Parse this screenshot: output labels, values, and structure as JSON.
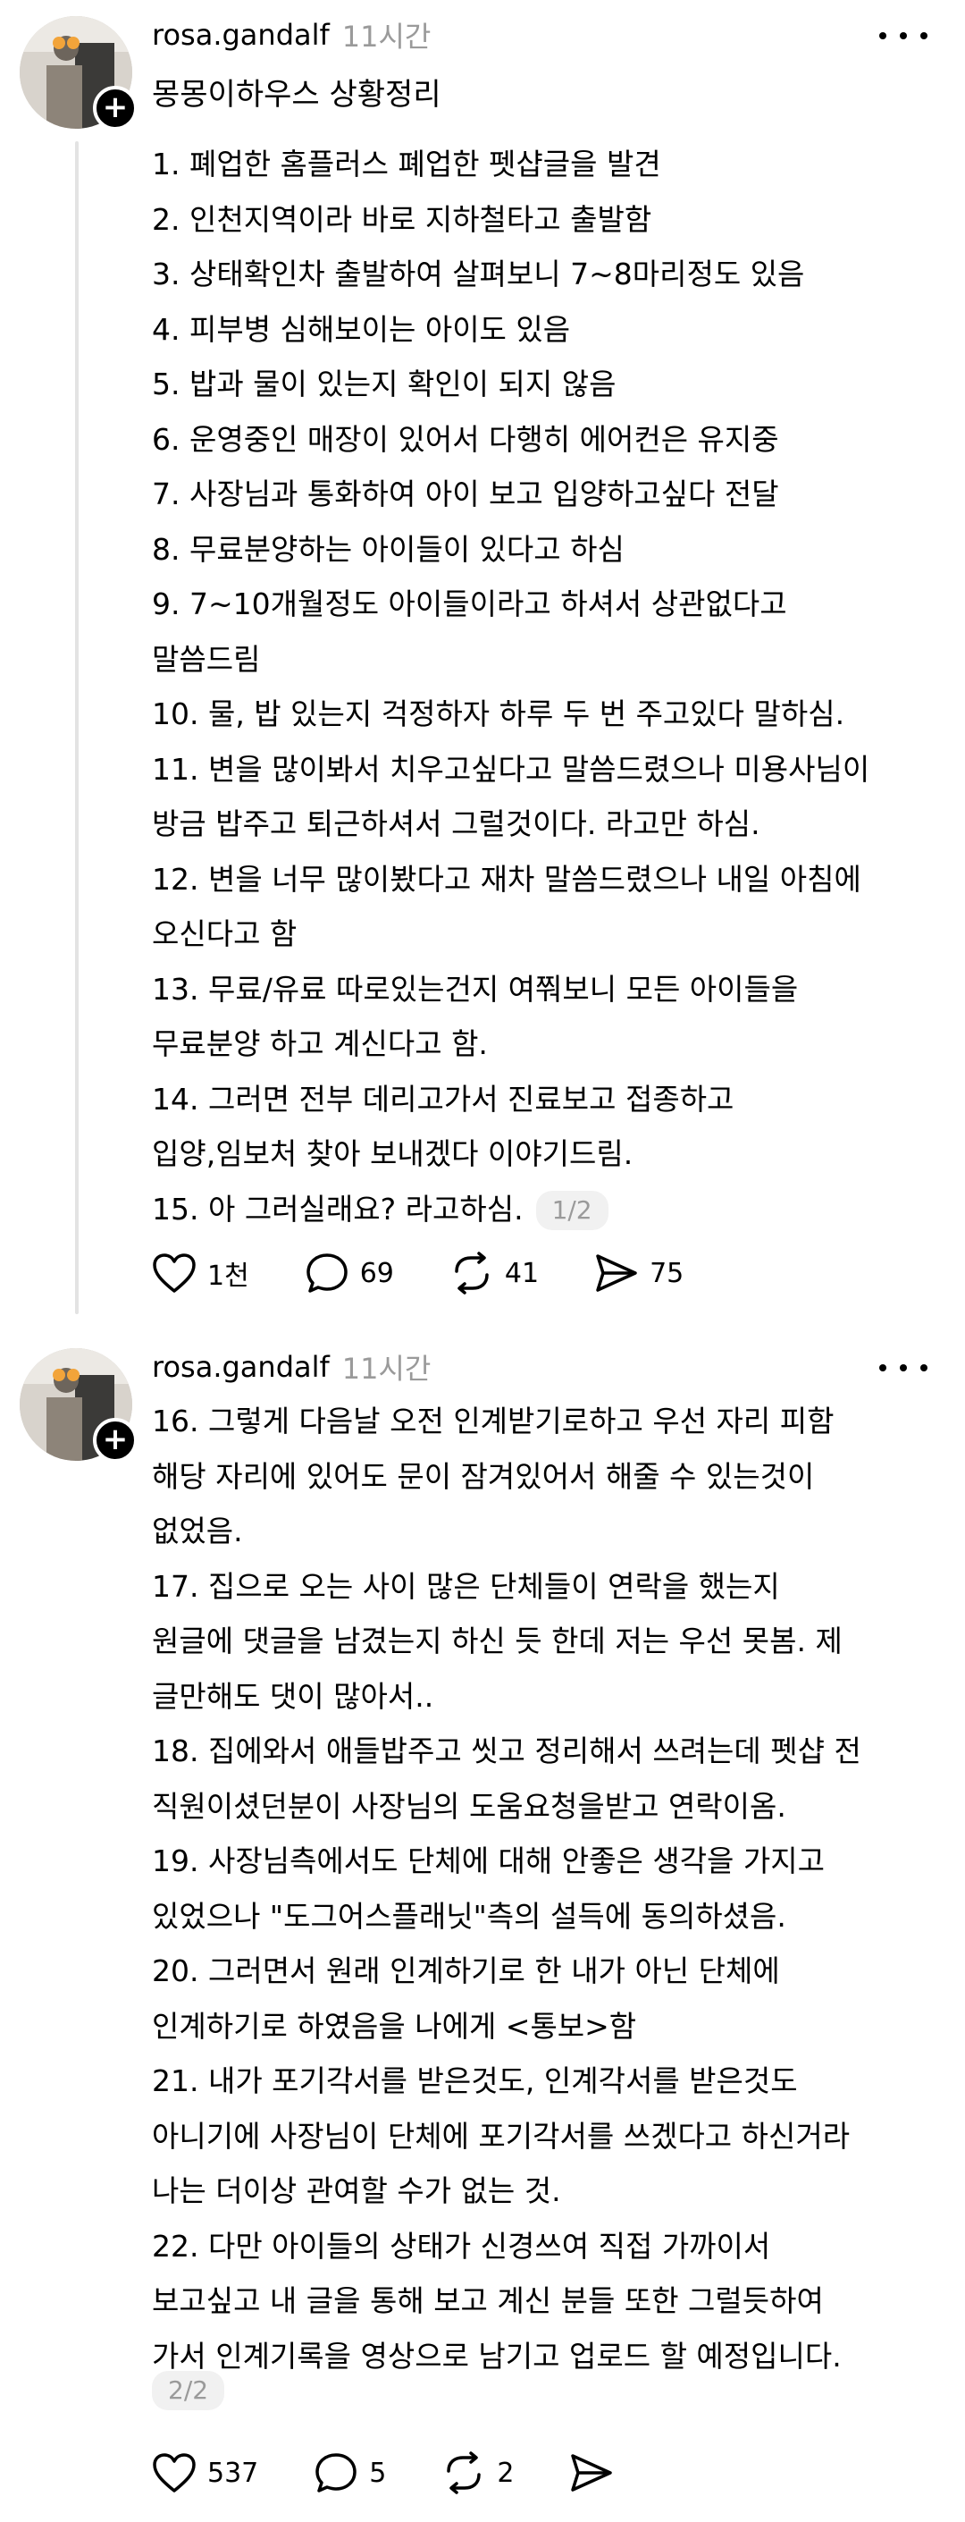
{
  "posts": [
    {
      "username": "rosa.gandalf",
      "time": "11시간",
      "title": "몽몽이하우스 상황정리",
      "lines": [
        "1. 폐업한 홈플러스 폐업한 펫샵글을 발견",
        "2. 인천지역이라 바로 지하철타고 출발함",
        "3. 상태확인차 출발하여 살펴보니 7~8마리정도 있음",
        "4. 피부병 심해보이는 아이도 있음",
        "5. 밥과 물이 있는지 확인이 되지 않음",
        "6. 운영중인 매장이 있어서 다행히 에어컨은 유지중",
        "7. 사장님과 통화하여 아이 보고 입양하고싶다 전달",
        "8. 무료분양하는 아이들이 있다고 하심",
        "9. 7~10개월정도 아이들이라고 하셔서 상관없다고",
        "말씀드림",
        "10. 물, 밥 있는지 걱정하자 하루 두 번 주고있다 말하심.",
        "11. 변을 많이봐서 치우고싶다고 말씀드렸으나 미용사님이",
        "방금 밥주고 퇴근하셔서 그럴것이다. 라고만 하심.",
        "12. 변을 너무 많이봤다고 재차 말씀드렸으나 내일 아침에",
        "오신다고 함",
        "13. 무료/유료 따로있는건지 여쭤보니 모든 아이들을",
        "무료분양 하고 계신다고 함.",
        "14. 그러면 전부 데리고가서 진료보고 접종하고",
        "입양,임보처 찾아 보내겠다 이야기드림.",
        "15. 아 그러실래요? 라고하심."
      ],
      "page_badge": "1/2",
      "likes": "1천",
      "comments": "69",
      "reposts": "41",
      "shares": "75"
    },
    {
      "username": "rosa.gandalf",
      "time": "11시간",
      "lines": [
        "16. 그렇게 다음날 오전 인계받기로하고 우선 자리 피함",
        "해당 자리에 있어도 문이 잠겨있어서 해줄 수 있는것이",
        "없었음.",
        "17. 집으로 오는 사이 많은 단체들이 연락을 했는지",
        "원글에 댓글을 남겼는지 하신 듯 한데 저는 우선 못봄. 제",
        "글만해도 댓이 많아서..",
        "18. 집에와서 애들밥주고 씻고 정리해서 쓰려는데 펫샵 전",
        "직원이셨던분이 사장님의 도움요청을받고 연락이옴.",
        "19. 사장님측에서도 단체에 대해 안좋은 생각을 가지고",
        "있었으나 \"도그어스플래닛\"측의 설득에 동의하셨음.",
        "20. 그러면서 원래 인계하기로 한 내가 아닌 단체에",
        "인계하기로 하였음을 나에게 <통보>함",
        "21. 내가 포기각서를 받은것도, 인계각서를 받은것도",
        "아니기에 사장님이 단체에 포기각서를 쓰겠다고 하신거라",
        "나는 더이상 관여할 수가 없는 것.",
        "22. 다만 아이들의 상태가 신경쓰여 직접 가까이서",
        "보고싶고 내 글을 통해 보고 계신 분들 또한 그럴듯하여",
        "가서 인계기록을 영상으로 남기고 업로드 할 예정입니다."
      ],
      "page_badge": "2/2",
      "likes": "537",
      "comments": "5",
      "reposts": "2"
    }
  ],
  "icons": [
    "plus-icon",
    "more-icon",
    "heart-icon",
    "comment-icon",
    "repost-icon",
    "share-icon"
  ]
}
